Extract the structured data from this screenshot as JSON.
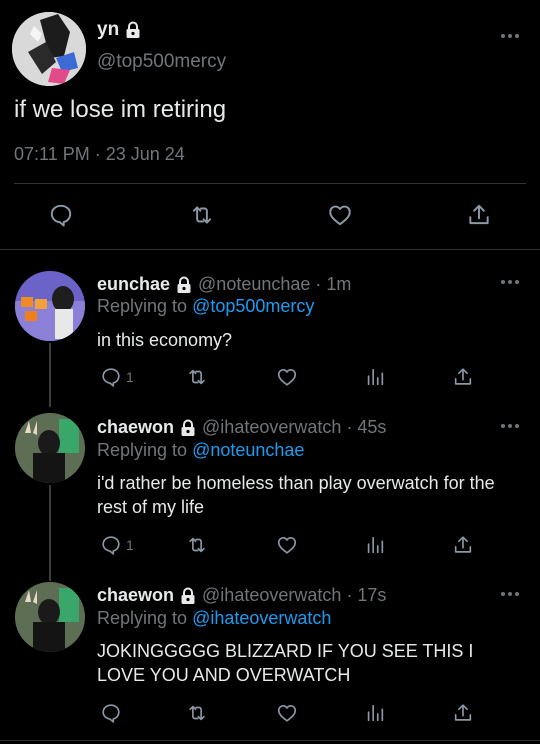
{
  "main_tweet": {
    "display_name": "yn",
    "handle": "@top500mercy",
    "text": "if we lose im retiring",
    "timestamp": "07:11 PM · 23 Jun 24",
    "icons": [
      "lock-icon",
      "more-icon",
      "reply-icon",
      "retweet-icon",
      "like-icon",
      "share-icon"
    ]
  },
  "replies": [
    {
      "display_name": "eunchae",
      "handle_time": "@noteunchae · 1m",
      "replying_label": "Replying to",
      "replying_to": "@top500mercy",
      "text": "in this economy?",
      "reply_count": "1"
    },
    {
      "display_name": "chaewon",
      "handle_time": "@ihateoverwatch · 45s",
      "replying_label": "Replying to",
      "replying_to": "@noteunchae",
      "text": "i'd rather be homeless than play overwatch for the rest of my life",
      "reply_count": "1"
    },
    {
      "display_name": "chaewon",
      "handle_time": "@ihateoverwatch · 17s",
      "replying_label": "Replying to",
      "replying_to": "@ihateoverwatch",
      "text": "JOKINGGGGG BLIZZARD IF YOU SEE THIS I LOVE YOU AND OVERWATCH",
      "reply_count": ""
    }
  ],
  "colors": {
    "background": "#000000",
    "text": "#e7e9ea",
    "muted": "#71767b",
    "link": "#1d9bf0",
    "divider": "#2f3336"
  }
}
